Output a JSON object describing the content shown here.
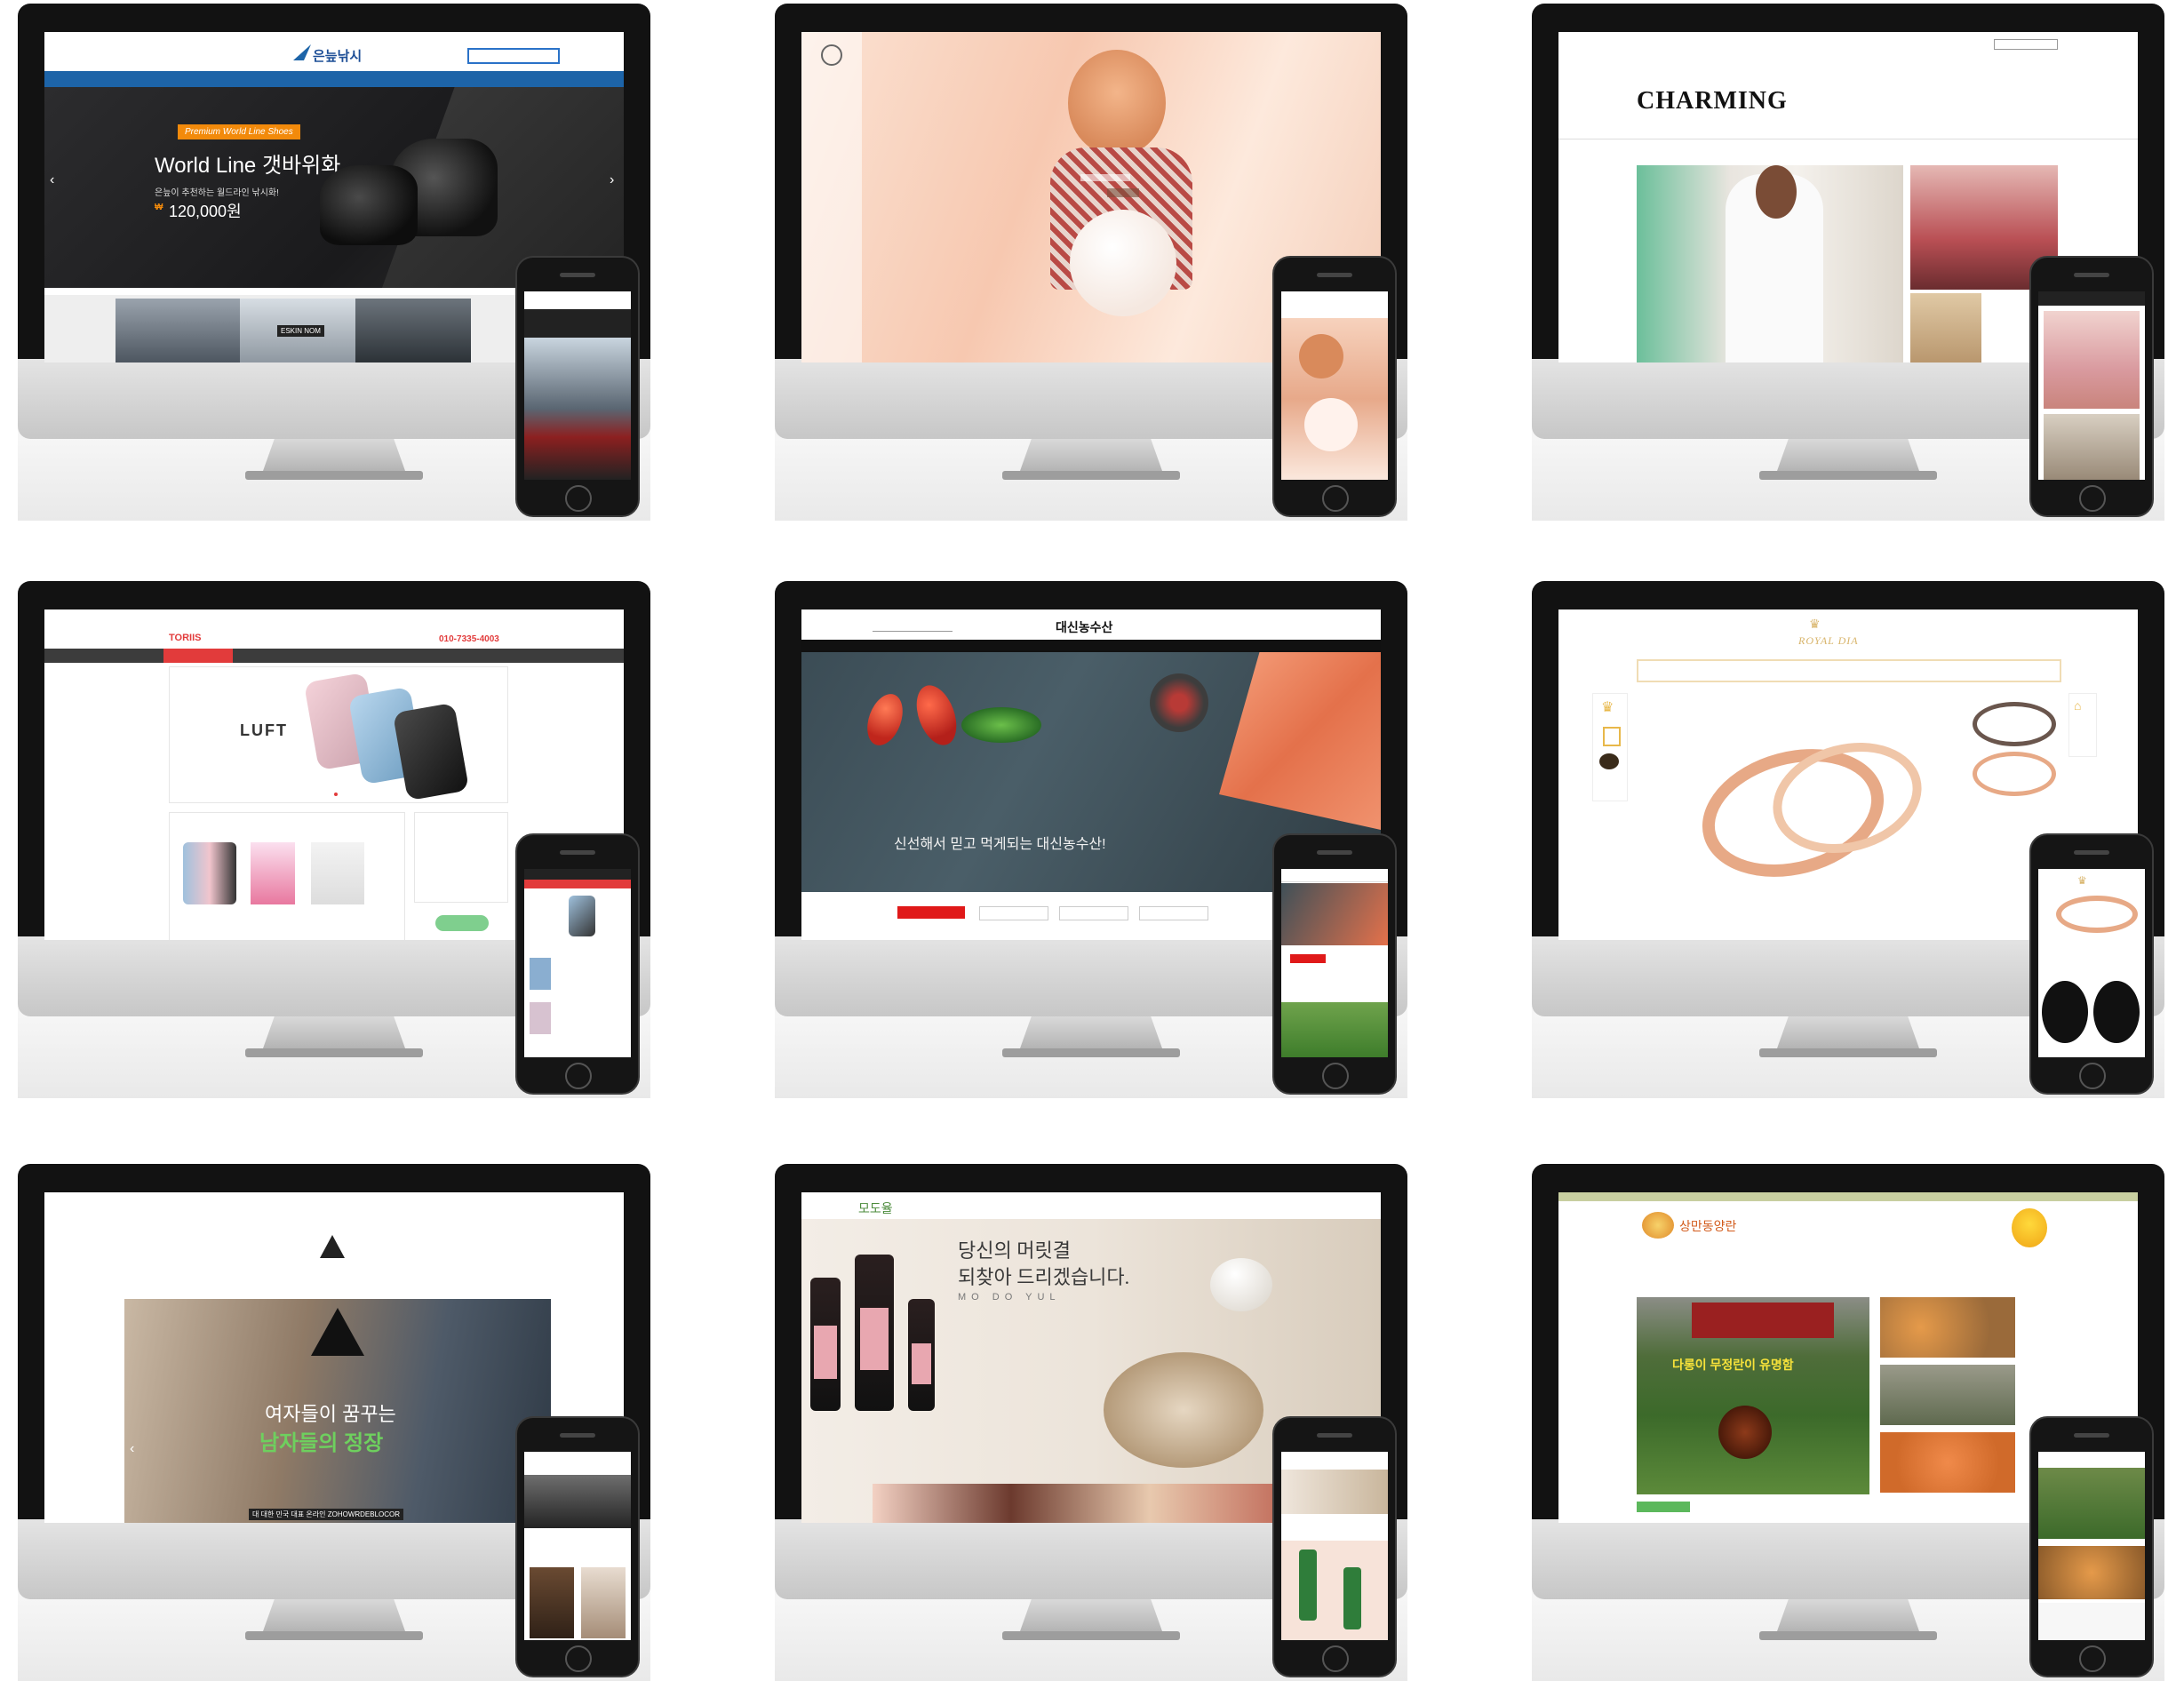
{
  "tiles": [
    {
      "name": "fishing",
      "logo": "은늪낚시",
      "promo_badge": "Premium World Line Shoes",
      "headline": "World Line 갯바위화",
      "subline": "은늪이 추천하는 월드라인 낚시화!",
      "price": "120,000원",
      "price_symbol": "₩",
      "brand_banner": "ESKIN NOM",
      "colors": {
        "nav": "#1d64a8",
        "badge": "#f28a0b"
      }
    },
    {
      "name": "kids",
      "logo": "Baby shop logo"
    },
    {
      "name": "charming",
      "logo": "CHARMING"
    },
    {
      "name": "toriis",
      "logo": "TORIIS",
      "phone_number": "010-7335-4003",
      "product": "LUFT",
      "colors": {
        "accent": "#e23b3b"
      }
    },
    {
      "name": "daesin",
      "logo": "대신농수산",
      "headline": "신선해서 믿고 먹게되는 대신농수산!",
      "colors": {
        "accent": "#e01919"
      }
    },
    {
      "name": "royal-dia",
      "logo": "ROYAL DIA",
      "colors": {
        "gold": "#d8b46a"
      }
    },
    {
      "name": "fashion-mens",
      "headline_line1": "여자들이 꿈꾸는",
      "headline_line2": "남자들의 정장",
      "bottom_note": "대 대한 민국 대표 온라인 ZOHOWRDEBLOCOR"
    },
    {
      "name": "modoyul",
      "logo": "모도율",
      "headline_line1": "당신의 머릿결",
      "headline_line2": "되찾아 드리겠습니다.",
      "brand": "MO DO YUL"
    },
    {
      "name": "egg-farm",
      "logo": "상만동양란",
      "banner": "다롱이 무정란이 유명함"
    }
  ]
}
